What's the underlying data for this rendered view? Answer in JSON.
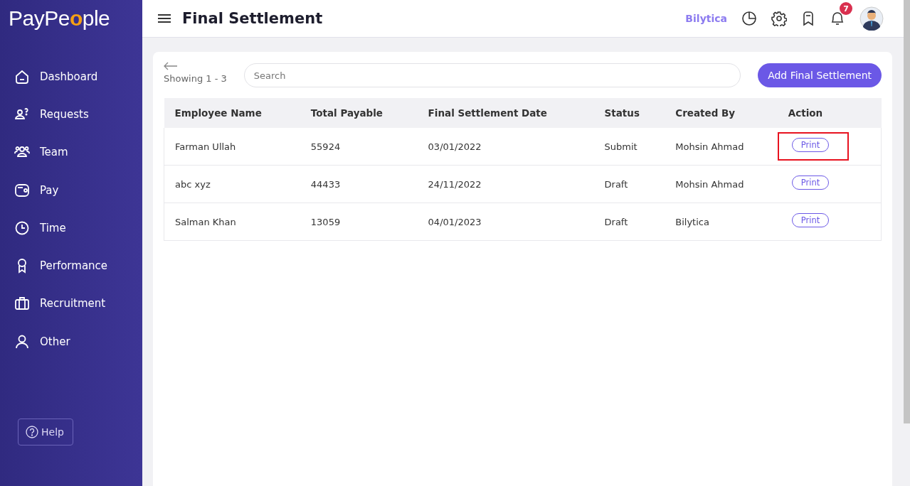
{
  "sidebar": {
    "logo": {
      "before": "PayPe",
      "accent": "o",
      "after": "ple"
    },
    "items": [
      {
        "label": "Dashboard"
      },
      {
        "label": "Requests"
      },
      {
        "label": "Team"
      },
      {
        "label": "Pay"
      },
      {
        "label": "Time"
      },
      {
        "label": "Performance"
      },
      {
        "label": "Recruitment"
      },
      {
        "label": "Other"
      }
    ],
    "help": "Help"
  },
  "header": {
    "title": "Final Settlement",
    "company": "Bilytica",
    "notifications": "7"
  },
  "toolbar": {
    "showing": "Showing 1 - 3",
    "search": {
      "placeholder": "Search"
    },
    "add_button": "Add Final Settlement"
  },
  "table": {
    "columns": [
      "Employee Name",
      "Total Payable",
      "Final Settlement Date",
      "Status",
      "Created By",
      "Action"
    ],
    "rows": [
      {
        "cells": [
          "Farman Ullah",
          "55924",
          "03/01/2022",
          "Submit",
          "Mohsin Ahmad"
        ],
        "action": "Print",
        "highlighted": true
      },
      {
        "cells": [
          "abc xyz",
          "44433",
          "24/11/2022",
          "Draft",
          "Mohsin Ahmad"
        ],
        "action": "Print",
        "highlighted": false
      },
      {
        "cells": [
          "Salman Khan",
          "13059",
          "04/01/2023",
          "Draft",
          "Bilytica"
        ],
        "action": "Print",
        "highlighted": false
      }
    ]
  }
}
